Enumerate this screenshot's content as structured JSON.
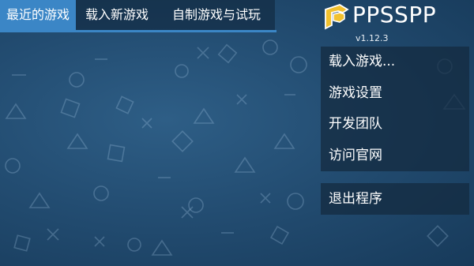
{
  "tabs": [
    {
      "label": "最近的游戏",
      "active": true
    },
    {
      "label": "载入新游戏",
      "active": false
    },
    {
      "label": "自制游戏与试玩",
      "active": false
    }
  ],
  "logo": {
    "name": "PPSSPP",
    "version": "v1.12.3",
    "icon": "ppsspp-logo-icon"
  },
  "menu": {
    "items": [
      {
        "label": "载入游戏..."
      },
      {
        "label": "游戏设置"
      },
      {
        "label": "开发团队"
      },
      {
        "label": "访问官网"
      }
    ],
    "exit_label": "退出程序"
  },
  "colors": {
    "accent": "#3b86c6",
    "background": "#234d72",
    "logo_yellow": "#f2c12e"
  }
}
